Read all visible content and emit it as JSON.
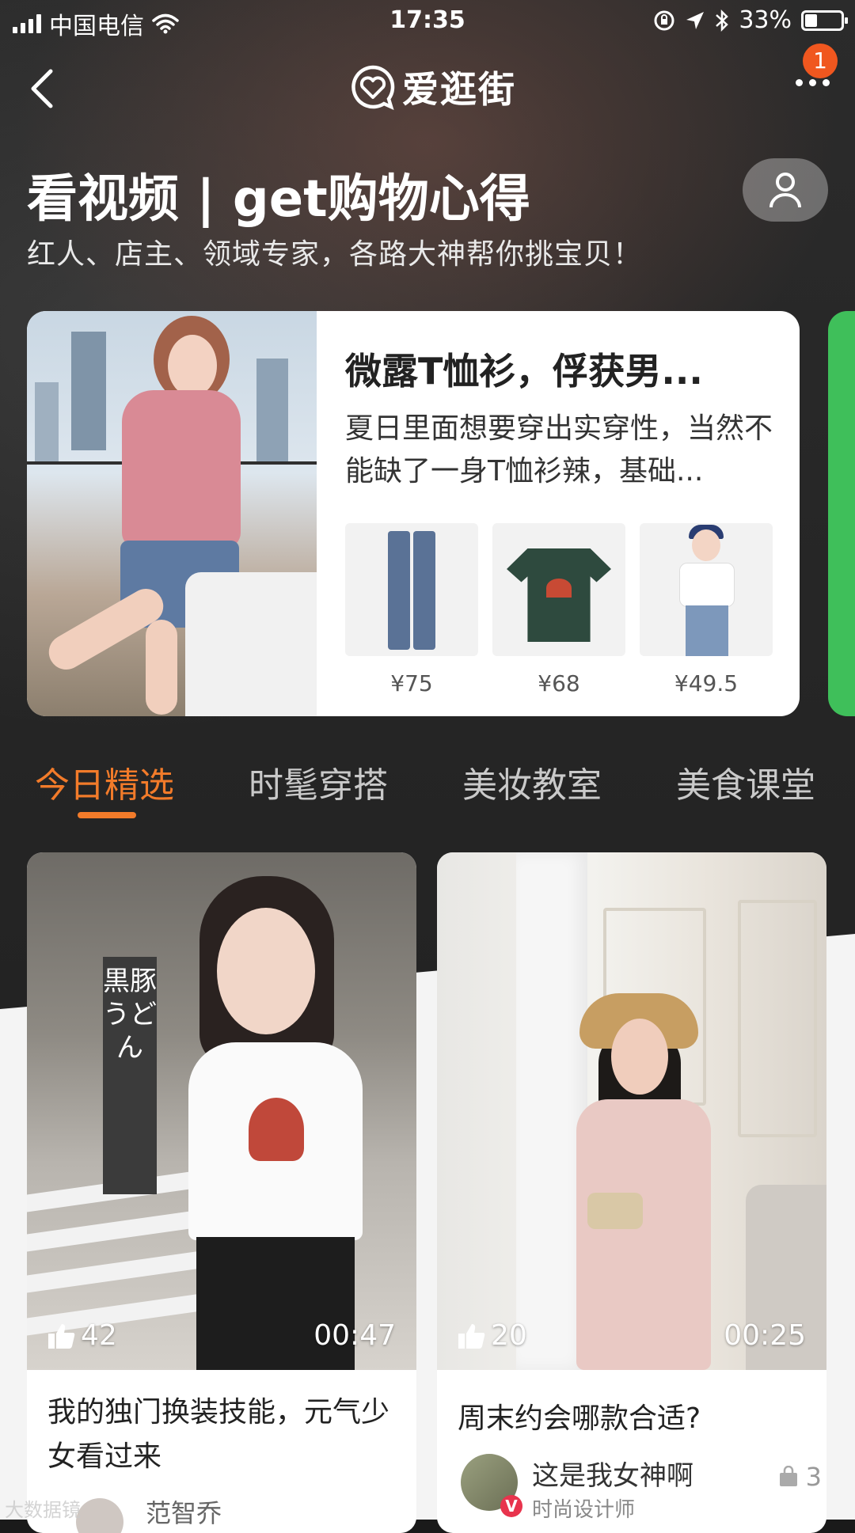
{
  "status_bar": {
    "carrier": "中国电信",
    "time": "17:35",
    "battery": "33%",
    "battery_level": 0.33
  },
  "nav": {
    "logo_text": "爱逛街",
    "notification_count": "1"
  },
  "header": {
    "title": "看视频 | get购物心得",
    "subtitle": "红人、店主、领域专家，各路大神帮你挑宝贝！"
  },
  "feature": {
    "title": "微露T恤衫，俘获男...",
    "description": "夏日里面想要穿出实穿性，当然不能缺了一身T恤衫辣，基础...",
    "products": [
      {
        "name": "jeans",
        "price": "¥75"
      },
      {
        "name": "tee",
        "price": "¥68"
      },
      {
        "name": "outfit",
        "price": "¥49.5"
      }
    ]
  },
  "tabs": [
    {
      "label": "今日精选",
      "active": true
    },
    {
      "label": "时髦穿搭",
      "active": false
    },
    {
      "label": "美妆教室",
      "active": false
    },
    {
      "label": "美食课堂",
      "active": false
    }
  ],
  "videos": [
    {
      "likes": "42",
      "duration": "00:47",
      "title": "我的独门换装技能，元气少女看过来",
      "sign_text": "黒豚うどん",
      "author_name": "范智乔"
    },
    {
      "likes": "20",
      "duration": "00:25",
      "title": "周末约会哪款合适?",
      "author_name": "这是我女神啊",
      "author_role": "时尚设计师",
      "product_count": "3"
    }
  ],
  "colors": {
    "accent": "#f27b2a",
    "badge": "#f0571f",
    "verified": "#e8344d"
  },
  "watermark": "大数据镜"
}
